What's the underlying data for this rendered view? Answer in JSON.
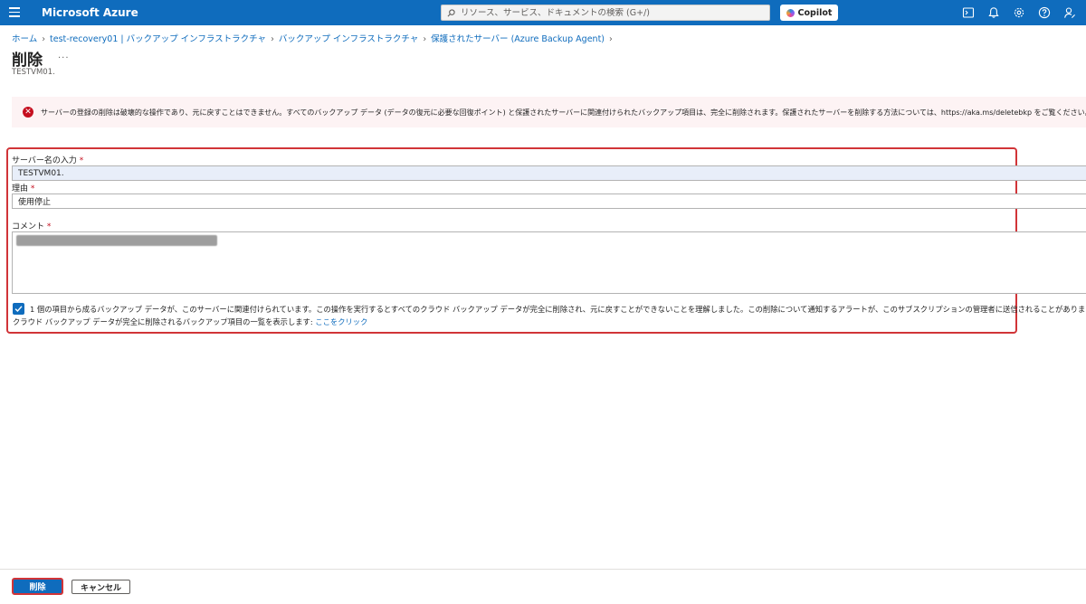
{
  "topbar": {
    "brand": "Microsoft Azure",
    "search_placeholder": "リソース、サービス、ドキュメントの検索 (G+/)",
    "copilot_label": "Copilot",
    "accent": "#0f6cbd",
    "icons": [
      "cloud-shell-icon",
      "notifications-icon",
      "settings-icon",
      "help-icon",
      "feedback-icon"
    ]
  },
  "breadcrumb": {
    "items": [
      "ホーム",
      "test-recovery01 | バックアップ インフラストラクチャ",
      "バックアップ インフラストラクチャ",
      "保護されたサーバー (Azure Backup Agent)"
    ]
  },
  "page": {
    "title": "削除",
    "more": "...",
    "subtitle": "TESTVM01."
  },
  "alert": {
    "text": "サーバーの登録の削除は破壊的な操作であり、元に戻すことはできません。すべてのバックアップ データ (データの復元に必要な回復ポイント) と保護されたサーバーに関連付けられたバックアップ項目は、完全に削除されます。保護されたサーバーを削除する方法については、https://aka.ms/deletebkp をご覧ください。",
    "color": "#c50f1f"
  },
  "form": {
    "server_name_label": "サーバー名の入力",
    "server_name_value": "TESTVM01.",
    "reason_label": "理由",
    "reason_value": "使用停止",
    "comment_label": "コメント",
    "required_mark": "*",
    "confirm_text": "1 個の項目から成るバックアップ データが、このサーバーに関連付けられています。この操作を実行するとすべてのクラウド バックアップ データが完全に削除され、元に戻すことができないことを理解しました。この削除について通知するアラートが、このサブスクリプションの管理者に送信されることがあります。",
    "list_text": "クラウド バックアップ データが完全に削除されるバックアップ項目の一覧を表示します:",
    "list_link": "ここをクリック"
  },
  "footer": {
    "delete_label": "削除",
    "cancel_label": "キャンセル"
  }
}
